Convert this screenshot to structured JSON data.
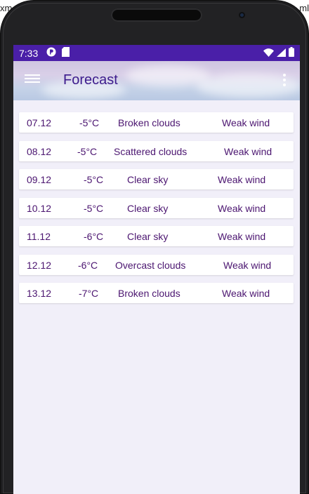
{
  "ide": {
    "left_text": "xm",
    "right_text": "ml"
  },
  "status": {
    "time": "7:33"
  },
  "appbar": {
    "title": "Forecast"
  },
  "forecast": [
    {
      "date": "07.12",
      "temp": "-5°C",
      "description": "Broken clouds",
      "wind": "Weak wind"
    },
    {
      "date": "08.12",
      "temp": "-5°C",
      "description": "Scattered clouds",
      "wind": "Weak wind"
    },
    {
      "date": "09.12",
      "temp": "-5°C",
      "description": "Clear sky",
      "wind": "Weak wind"
    },
    {
      "date": "10.12",
      "temp": "-5°C",
      "description": "Clear sky",
      "wind": "Weak wind"
    },
    {
      "date": "11.12",
      "temp": "-6°C",
      "description": "Clear sky",
      "wind": "Weak wind"
    },
    {
      "date": "12.12",
      "temp": "-6°C",
      "description": "Overcast clouds",
      "wind": "Weak wind"
    },
    {
      "date": "13.12",
      "temp": "-7°C",
      "description": "Broken clouds",
      "wind": "Weak wind"
    }
  ],
  "icons": {
    "menu": "hamburger-icon",
    "overflow": "more-vert-icon",
    "status_left": [
      "p-icon",
      "sd-card-icon"
    ],
    "status_right": [
      "wifi-icon",
      "signal-icon",
      "battery-icon"
    ]
  },
  "colors": {
    "statusbar": "#4a1fa8",
    "title": "#3c1b8c",
    "row_text": "#4b1570",
    "screen_bg": "#f1eff9"
  }
}
